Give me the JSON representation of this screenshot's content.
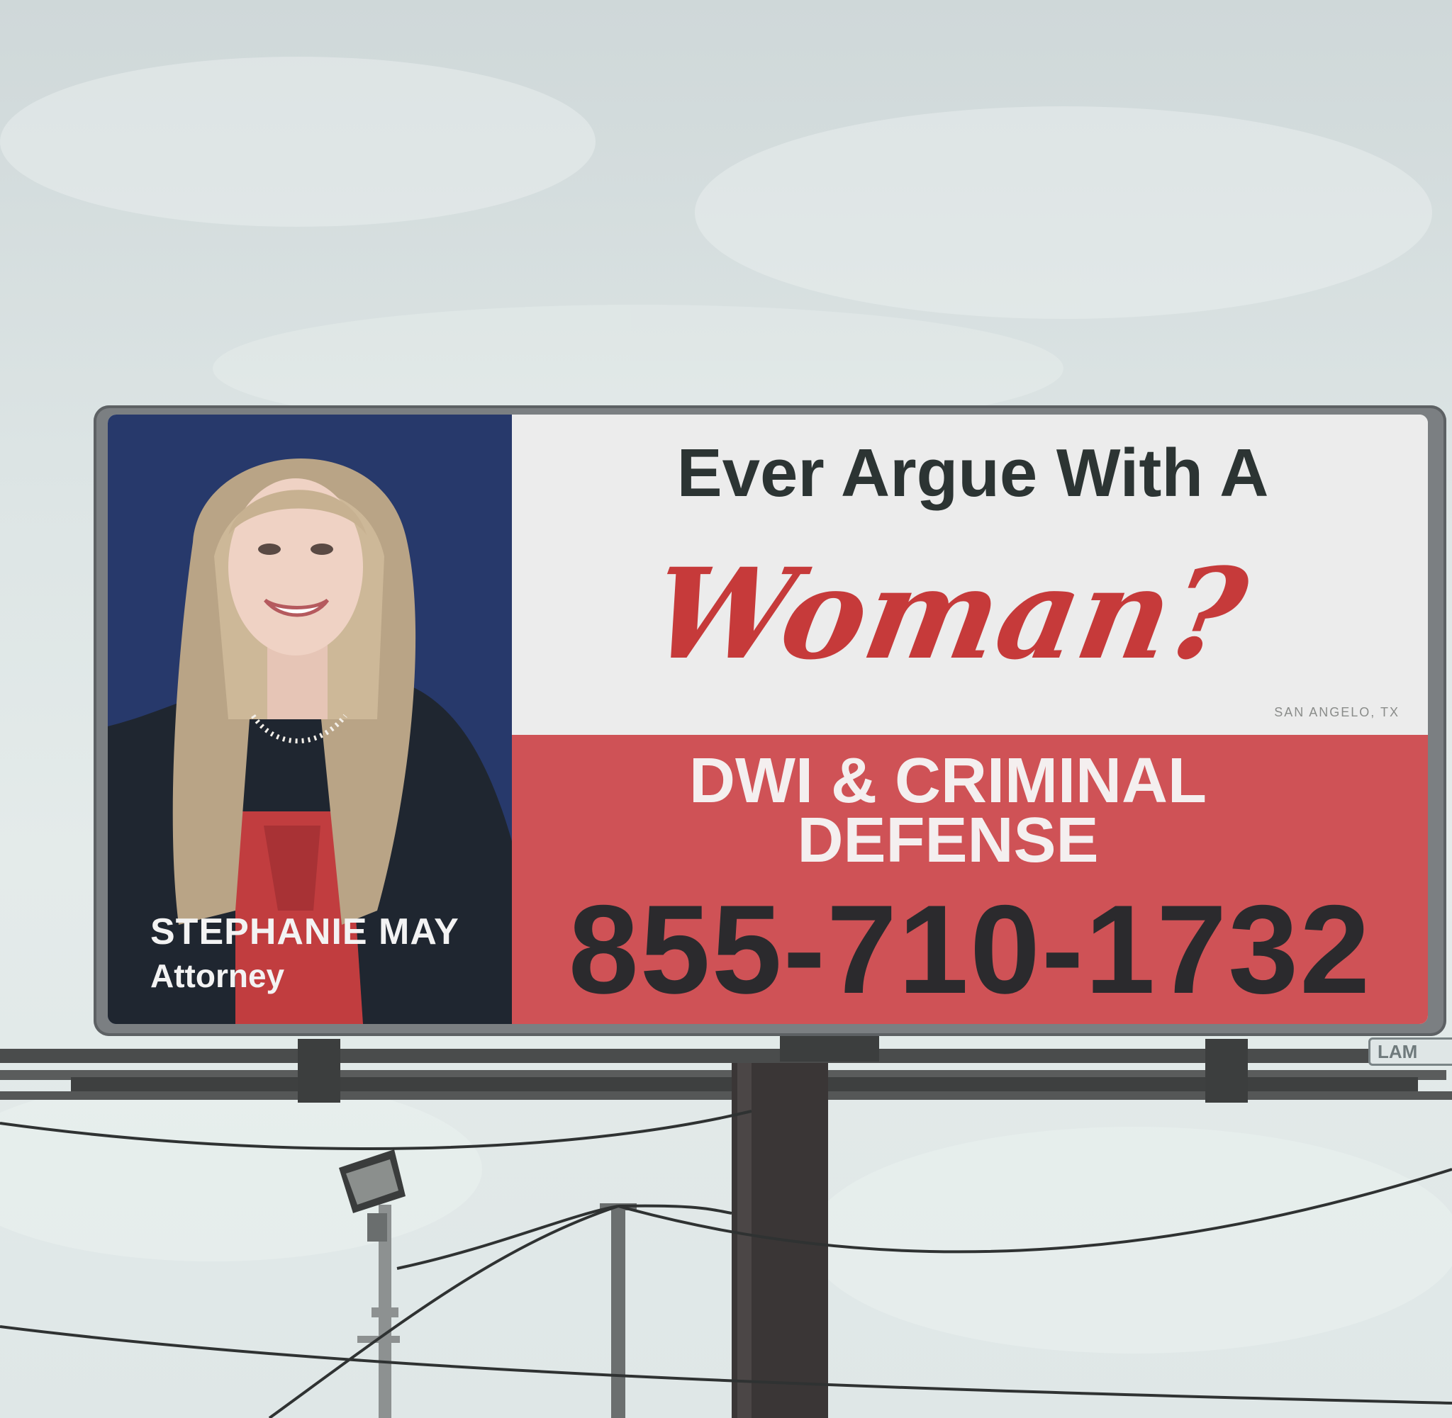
{
  "billboard": {
    "headline": "Ever Argue With A",
    "script_word": "Woman?",
    "location": "SAN ANGELO, TX",
    "service_line1": "DWI & CRIMINAL",
    "service_line2": "DEFENSE",
    "phone": "855-710-1732",
    "attorney_name": "STEPHANIE MAY",
    "attorney_title": "Attorney"
  },
  "street_sign": {
    "text": "LAM"
  },
  "colors": {
    "sky": "#dde5e5",
    "left_panel_blue": "#27396b",
    "top_panel_white": "#ececec",
    "bottom_panel_red": "#cf5256",
    "headline_dark": "#2c3433",
    "script_red": "#c63a3a",
    "phone_dark": "#2b2a2d"
  }
}
